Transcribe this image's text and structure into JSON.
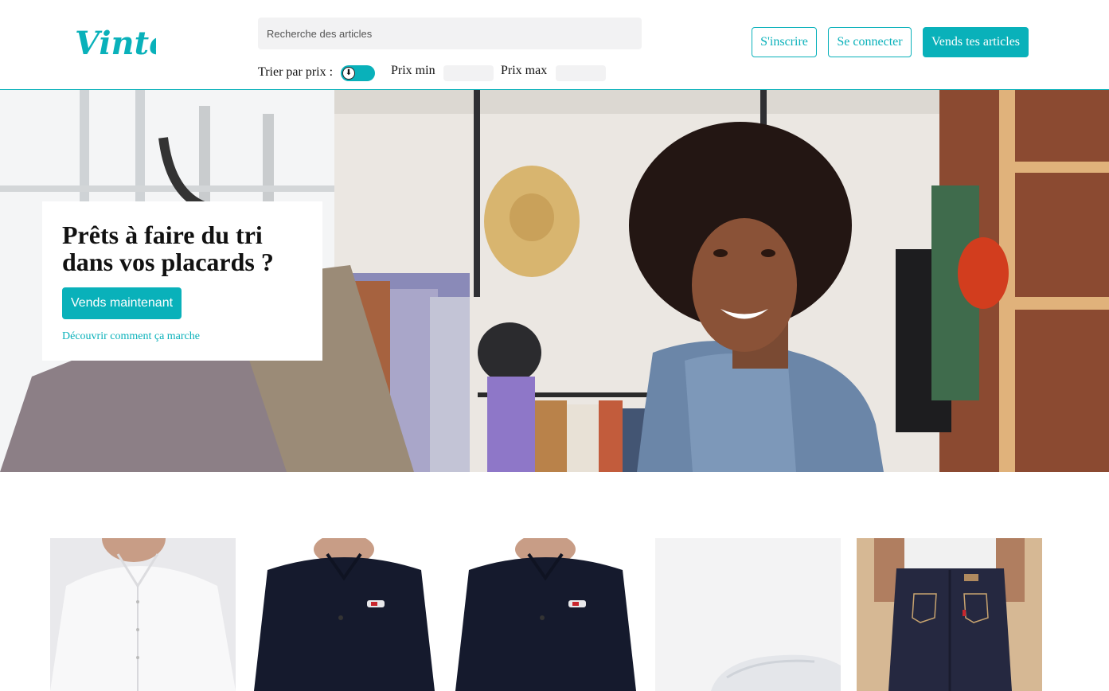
{
  "header": {
    "logo_text": "Vinted",
    "search_placeholder": "Recherche des articles",
    "sort_label": "Trier par prix :",
    "price_min_label": "Prix min",
    "price_max_label": "Prix max",
    "signup_label": "S'inscrire",
    "login_label": "Se connecter",
    "sell_label": "Vends tes articles"
  },
  "hero": {
    "title": "Prêts à faire du tri dans vos placards ?",
    "cta_label": "Vends maintenant",
    "link_label": "Découvrir comment ça marche"
  },
  "colors": {
    "brand": "#09b1ba",
    "input_bg": "#f2f2f3"
  },
  "products": [
    {
      "image": "white shirt"
    },
    {
      "image": "navy polo shirt"
    },
    {
      "image": "navy polo shirt"
    },
    {
      "image": "white sneaker"
    },
    {
      "image": "dark denim jeans"
    }
  ]
}
